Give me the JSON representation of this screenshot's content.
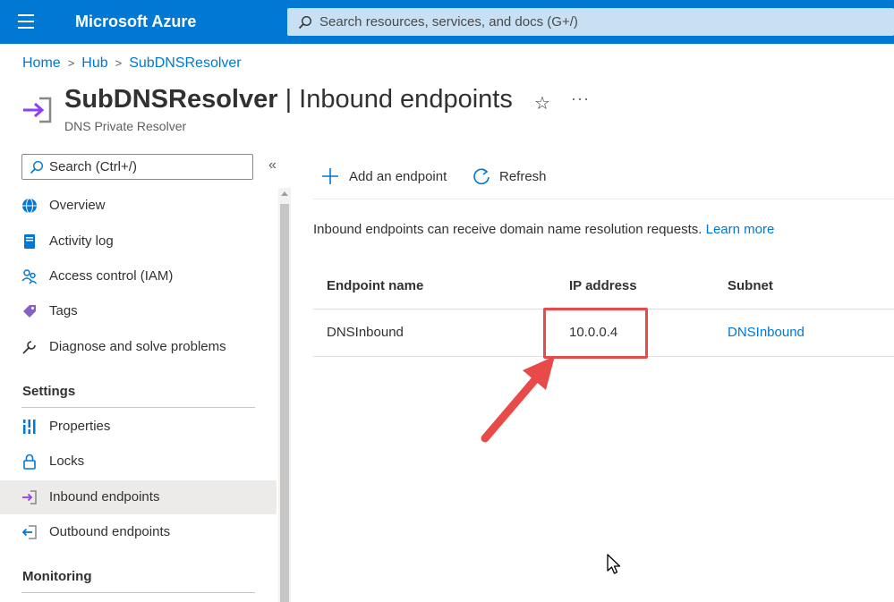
{
  "topbar": {
    "brand": "Microsoft Azure",
    "search_placeholder": "Search resources, services, and docs (G+/)"
  },
  "breadcrumb": [
    "Home",
    "Hub",
    "SubDNSResolver"
  ],
  "header": {
    "resource_name": "SubDNSResolver",
    "separator": " | ",
    "page_name": "Inbound endpoints",
    "subtitle": "DNS Private Resolver",
    "star": "☆",
    "more": "···"
  },
  "sidebar": {
    "search_placeholder": "Search (Ctrl+/)",
    "collapse": "«",
    "items": [
      {
        "label": "Overview",
        "icon": "globe-icon"
      },
      {
        "label": "Activity log",
        "icon": "log-icon"
      },
      {
        "label": "Access control (IAM)",
        "icon": "people-icon"
      },
      {
        "label": "Tags",
        "icon": "tag-icon"
      },
      {
        "label": "Diagnose and solve problems",
        "icon": "wrench-icon"
      }
    ],
    "settings_title": "Settings",
    "settings_items": [
      {
        "label": "Properties",
        "icon": "properties-icon"
      },
      {
        "label": "Locks",
        "icon": "lock-icon"
      },
      {
        "label": "Inbound endpoints",
        "icon": "inbound-icon",
        "active": true
      },
      {
        "label": "Outbound endpoints",
        "icon": "outbound-icon"
      }
    ],
    "monitoring_title": "Monitoring"
  },
  "commands": {
    "add": "Add an endpoint",
    "refresh": "Refresh"
  },
  "info": {
    "text": "Inbound endpoints can receive domain name resolution requests. ",
    "link": "Learn more"
  },
  "table": {
    "headers": [
      "Endpoint name",
      "IP address",
      "Subnet"
    ],
    "rows": [
      {
        "name": "DNSInbound",
        "ip": "10.0.0.4",
        "subnet": "DNSInbound"
      }
    ]
  },
  "colors": {
    "accent": "#0078d4",
    "annotation": "#e84a4a"
  }
}
